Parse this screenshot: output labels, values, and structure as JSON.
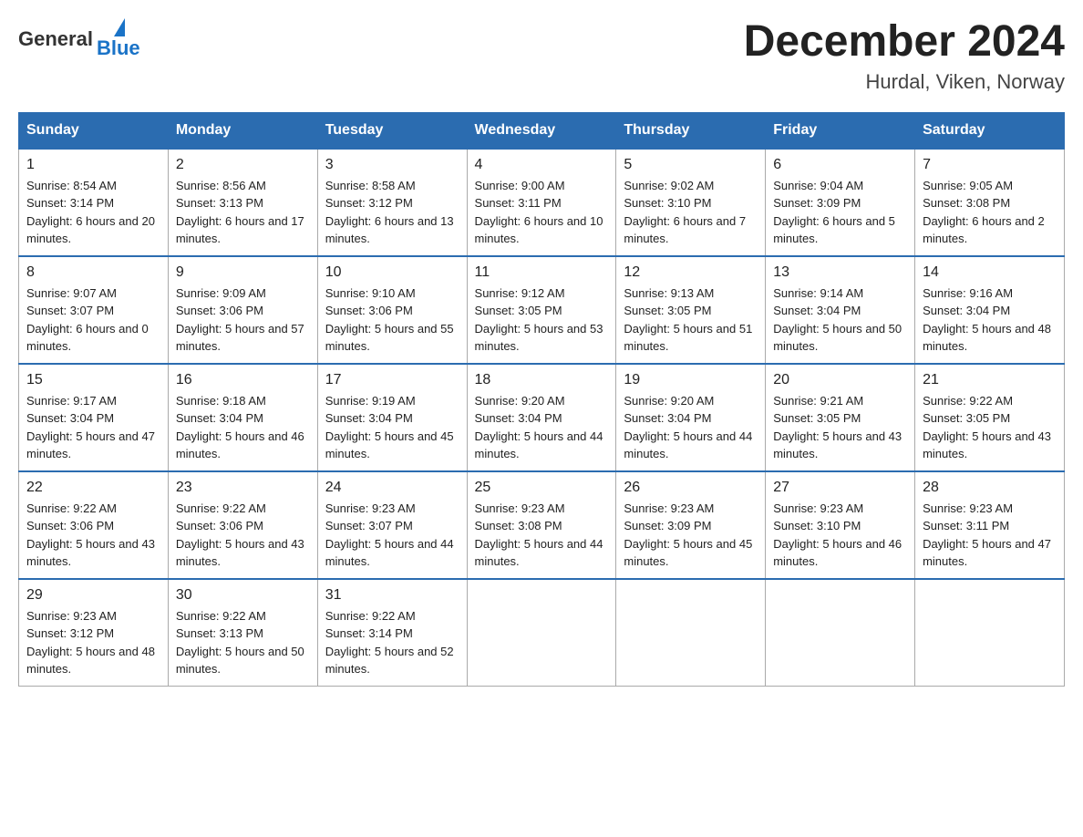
{
  "header": {
    "logo_general": "General",
    "logo_blue": "Blue",
    "month_title": "December 2024",
    "location": "Hurdal, Viken, Norway"
  },
  "days_of_week": [
    "Sunday",
    "Monday",
    "Tuesday",
    "Wednesday",
    "Thursday",
    "Friday",
    "Saturday"
  ],
  "weeks": [
    [
      {
        "day": "1",
        "sunrise": "Sunrise: 8:54 AM",
        "sunset": "Sunset: 3:14 PM",
        "daylight": "Daylight: 6 hours and 20 minutes."
      },
      {
        "day": "2",
        "sunrise": "Sunrise: 8:56 AM",
        "sunset": "Sunset: 3:13 PM",
        "daylight": "Daylight: 6 hours and 17 minutes."
      },
      {
        "day": "3",
        "sunrise": "Sunrise: 8:58 AM",
        "sunset": "Sunset: 3:12 PM",
        "daylight": "Daylight: 6 hours and 13 minutes."
      },
      {
        "day": "4",
        "sunrise": "Sunrise: 9:00 AM",
        "sunset": "Sunset: 3:11 PM",
        "daylight": "Daylight: 6 hours and 10 minutes."
      },
      {
        "day": "5",
        "sunrise": "Sunrise: 9:02 AM",
        "sunset": "Sunset: 3:10 PM",
        "daylight": "Daylight: 6 hours and 7 minutes."
      },
      {
        "day": "6",
        "sunrise": "Sunrise: 9:04 AM",
        "sunset": "Sunset: 3:09 PM",
        "daylight": "Daylight: 6 hours and 5 minutes."
      },
      {
        "day": "7",
        "sunrise": "Sunrise: 9:05 AM",
        "sunset": "Sunset: 3:08 PM",
        "daylight": "Daylight: 6 hours and 2 minutes."
      }
    ],
    [
      {
        "day": "8",
        "sunrise": "Sunrise: 9:07 AM",
        "sunset": "Sunset: 3:07 PM",
        "daylight": "Daylight: 6 hours and 0 minutes."
      },
      {
        "day": "9",
        "sunrise": "Sunrise: 9:09 AM",
        "sunset": "Sunset: 3:06 PM",
        "daylight": "Daylight: 5 hours and 57 minutes."
      },
      {
        "day": "10",
        "sunrise": "Sunrise: 9:10 AM",
        "sunset": "Sunset: 3:06 PM",
        "daylight": "Daylight: 5 hours and 55 minutes."
      },
      {
        "day": "11",
        "sunrise": "Sunrise: 9:12 AM",
        "sunset": "Sunset: 3:05 PM",
        "daylight": "Daylight: 5 hours and 53 minutes."
      },
      {
        "day": "12",
        "sunrise": "Sunrise: 9:13 AM",
        "sunset": "Sunset: 3:05 PM",
        "daylight": "Daylight: 5 hours and 51 minutes."
      },
      {
        "day": "13",
        "sunrise": "Sunrise: 9:14 AM",
        "sunset": "Sunset: 3:04 PM",
        "daylight": "Daylight: 5 hours and 50 minutes."
      },
      {
        "day": "14",
        "sunrise": "Sunrise: 9:16 AM",
        "sunset": "Sunset: 3:04 PM",
        "daylight": "Daylight: 5 hours and 48 minutes."
      }
    ],
    [
      {
        "day": "15",
        "sunrise": "Sunrise: 9:17 AM",
        "sunset": "Sunset: 3:04 PM",
        "daylight": "Daylight: 5 hours and 47 minutes."
      },
      {
        "day": "16",
        "sunrise": "Sunrise: 9:18 AM",
        "sunset": "Sunset: 3:04 PM",
        "daylight": "Daylight: 5 hours and 46 minutes."
      },
      {
        "day": "17",
        "sunrise": "Sunrise: 9:19 AM",
        "sunset": "Sunset: 3:04 PM",
        "daylight": "Daylight: 5 hours and 45 minutes."
      },
      {
        "day": "18",
        "sunrise": "Sunrise: 9:20 AM",
        "sunset": "Sunset: 3:04 PM",
        "daylight": "Daylight: 5 hours and 44 minutes."
      },
      {
        "day": "19",
        "sunrise": "Sunrise: 9:20 AM",
        "sunset": "Sunset: 3:04 PM",
        "daylight": "Daylight: 5 hours and 44 minutes."
      },
      {
        "day": "20",
        "sunrise": "Sunrise: 9:21 AM",
        "sunset": "Sunset: 3:05 PM",
        "daylight": "Daylight: 5 hours and 43 minutes."
      },
      {
        "day": "21",
        "sunrise": "Sunrise: 9:22 AM",
        "sunset": "Sunset: 3:05 PM",
        "daylight": "Daylight: 5 hours and 43 minutes."
      }
    ],
    [
      {
        "day": "22",
        "sunrise": "Sunrise: 9:22 AM",
        "sunset": "Sunset: 3:06 PM",
        "daylight": "Daylight: 5 hours and 43 minutes."
      },
      {
        "day": "23",
        "sunrise": "Sunrise: 9:22 AM",
        "sunset": "Sunset: 3:06 PM",
        "daylight": "Daylight: 5 hours and 43 minutes."
      },
      {
        "day": "24",
        "sunrise": "Sunrise: 9:23 AM",
        "sunset": "Sunset: 3:07 PM",
        "daylight": "Daylight: 5 hours and 44 minutes."
      },
      {
        "day": "25",
        "sunrise": "Sunrise: 9:23 AM",
        "sunset": "Sunset: 3:08 PM",
        "daylight": "Daylight: 5 hours and 44 minutes."
      },
      {
        "day": "26",
        "sunrise": "Sunrise: 9:23 AM",
        "sunset": "Sunset: 3:09 PM",
        "daylight": "Daylight: 5 hours and 45 minutes."
      },
      {
        "day": "27",
        "sunrise": "Sunrise: 9:23 AM",
        "sunset": "Sunset: 3:10 PM",
        "daylight": "Daylight: 5 hours and 46 minutes."
      },
      {
        "day": "28",
        "sunrise": "Sunrise: 9:23 AM",
        "sunset": "Sunset: 3:11 PM",
        "daylight": "Daylight: 5 hours and 47 minutes."
      }
    ],
    [
      {
        "day": "29",
        "sunrise": "Sunrise: 9:23 AM",
        "sunset": "Sunset: 3:12 PM",
        "daylight": "Daylight: 5 hours and 48 minutes."
      },
      {
        "day": "30",
        "sunrise": "Sunrise: 9:22 AM",
        "sunset": "Sunset: 3:13 PM",
        "daylight": "Daylight: 5 hours and 50 minutes."
      },
      {
        "day": "31",
        "sunrise": "Sunrise: 9:22 AM",
        "sunset": "Sunset: 3:14 PM",
        "daylight": "Daylight: 5 hours and 52 minutes."
      },
      null,
      null,
      null,
      null
    ]
  ]
}
